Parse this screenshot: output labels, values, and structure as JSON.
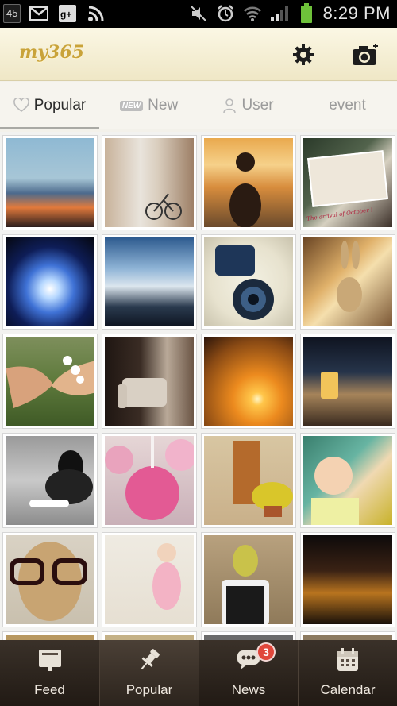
{
  "status_bar": {
    "notification_count": "45",
    "time": "8:29 PM",
    "icons": [
      "gmail-icon",
      "google-plus-icon",
      "rss-icon",
      "mute-icon",
      "alarm-icon",
      "wifi-icon",
      "signal-icon",
      "battery-icon"
    ]
  },
  "app": {
    "logo": "my365",
    "accent": "#c9a33a"
  },
  "header_icons": [
    "settings-gear-icon",
    "camera-icon"
  ],
  "tabs": [
    {
      "label": "Popular",
      "icon": "heart-icon",
      "active": true
    },
    {
      "label": "New",
      "icon": "new-badge-icon",
      "icon_text": "NEW",
      "active": false
    },
    {
      "label": "User",
      "icon": "user-icon",
      "active": false
    },
    {
      "label": "event",
      "icon": "",
      "active": false
    }
  ],
  "photos": [
    {
      "subject": "sunset over water",
      "caption": ""
    },
    {
      "subject": "street with bicycles",
      "caption": ""
    },
    {
      "subject": "dog at beach sunset",
      "caption": ""
    },
    {
      "subject": "dog postcard",
      "caption": "The arrival of October !"
    },
    {
      "subject": "blue sun flare",
      "caption": ""
    },
    {
      "subject": "clouds over harbor",
      "caption": ""
    },
    {
      "subject": "camera lens",
      "caption": ""
    },
    {
      "subject": "bunny toy",
      "caption": ""
    },
    {
      "subject": "holding hands with flowers",
      "caption": ""
    },
    {
      "subject": "armchair by window",
      "caption": ""
    },
    {
      "subject": "orange sunset",
      "caption": ""
    },
    {
      "subject": "restaurant interior",
      "caption": ""
    },
    {
      "subject": "black and white dog",
      "caption": ""
    },
    {
      "subject": "pink cake pops",
      "caption": ""
    },
    {
      "subject": "wooden door with flowers",
      "caption": ""
    },
    {
      "subject": "smiling baby",
      "caption": ""
    },
    {
      "subject": "dog with glasses",
      "caption": ""
    },
    {
      "subject": "baby in pink",
      "caption": ""
    },
    {
      "subject": "bird on phone",
      "caption": ""
    },
    {
      "subject": "city at night",
      "caption": ""
    }
  ],
  "bottom_nav": [
    {
      "label": "Feed",
      "icon": "feed-icon",
      "active": false
    },
    {
      "label": "Popular",
      "icon": "pin-icon",
      "active": true
    },
    {
      "label": "News",
      "icon": "chat-bubble-icon",
      "active": false,
      "badge": "3"
    },
    {
      "label": "Calendar",
      "icon": "calendar-icon",
      "active": false
    }
  ]
}
